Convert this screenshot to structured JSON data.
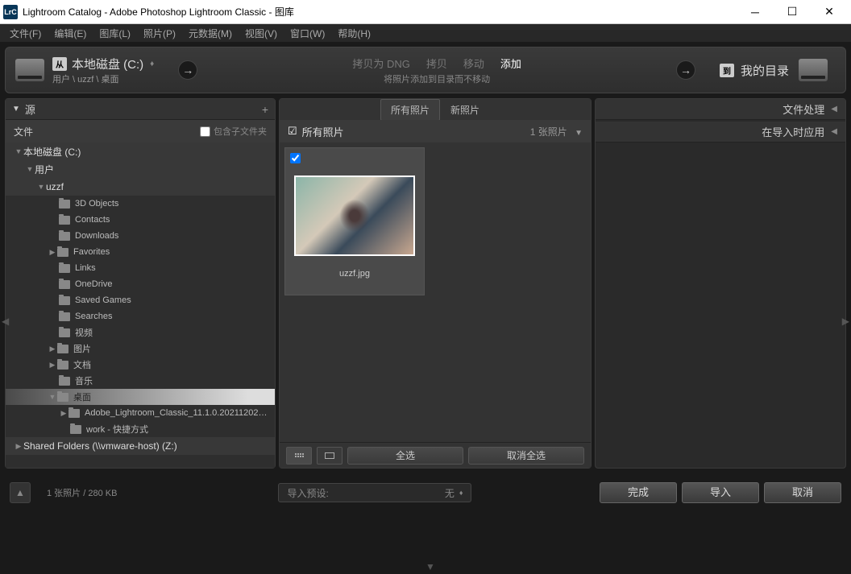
{
  "titlebar": {
    "icon_text": "LrC",
    "title": "Lightroom Catalog - Adobe Photoshop Lightroom Classic - 图库"
  },
  "menubar": {
    "items": [
      "文件(F)",
      "编辑(E)",
      "图库(L)",
      "照片(P)",
      "元数据(M)",
      "视图(V)",
      "窗口(W)",
      "帮助(H)"
    ]
  },
  "toolbar": {
    "from_badge": "从",
    "source_title": "本地磁盘 (C:)",
    "source_path": "用户 \\ uzzf \\ 桌面",
    "copy_as_dng": "拷贝为 DNG",
    "copy": "拷贝",
    "move": "移动",
    "add": "添加",
    "subtitle": "将照片添加到目录而不移动",
    "to_badge": "到",
    "dest_text": "我的目录"
  },
  "left_panel": {
    "header": "源",
    "file_label": "文件",
    "include_subfolders": "包含子文件夹",
    "tree": {
      "disk": "本地磁盘 (C:)",
      "users": "用户",
      "user": "uzzf",
      "items": [
        "3D Objects",
        "Contacts",
        "Downloads",
        "Favorites",
        "Links",
        "OneDrive",
        "Saved Games",
        "Searches",
        "视频",
        "图片",
        "文档",
        "音乐"
      ],
      "desktop": "桌面",
      "desktop_children": [
        "Adobe_Lightroom_Classic_11.1.0.2021120222...",
        "work - 快捷方式"
      ],
      "shared": "Shared Folders (\\\\vmware-host) (Z:)"
    }
  },
  "center_panel": {
    "tab_all": "所有照片",
    "tab_new": "新照片",
    "all_photos_label": "所有照片",
    "photo_count": "1 张照片",
    "thumb_filename": "uzzf.jpg",
    "select_all": "全选",
    "deselect_all": "取消全选"
  },
  "right_panel": {
    "file_handling": "文件处理",
    "apply_during": "在导入时应用"
  },
  "bottom": {
    "photo_info": "1 张照片 / 280 KB",
    "preset_label": "导入预设:",
    "preset_value": "无",
    "done": "完成",
    "import": "导入",
    "cancel": "取消"
  }
}
